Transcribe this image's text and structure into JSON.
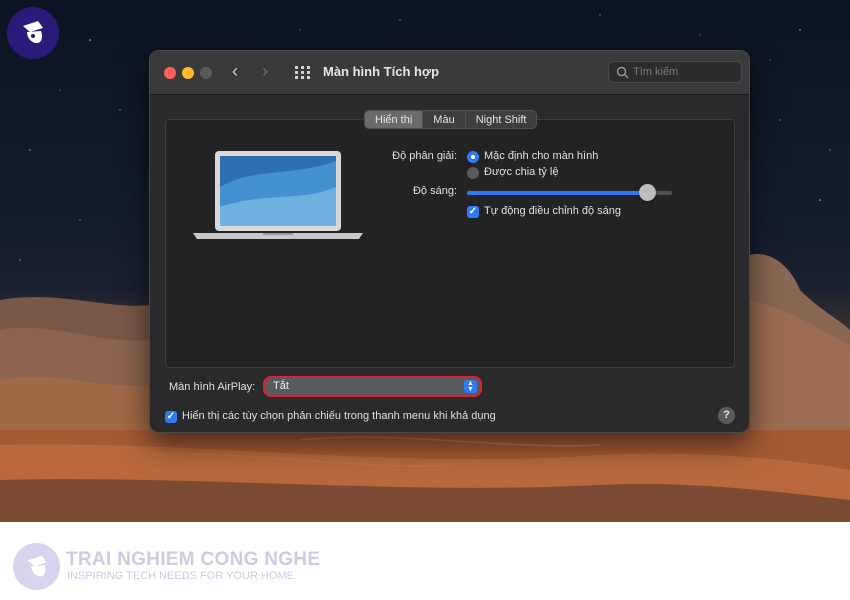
{
  "window": {
    "title": "Màn hình Tích hợp",
    "search_placeholder": "Tìm kiếm"
  },
  "tabs": [
    {
      "label": "Hiển thị",
      "active": true
    },
    {
      "label": "Màu",
      "active": false
    },
    {
      "label": "Night Shift",
      "active": false
    }
  ],
  "resolution": {
    "label": "Độ phân giải:",
    "options": [
      {
        "label": "Mặc định cho màn hình",
        "selected": true
      },
      {
        "label": "Được chia tỷ lệ",
        "selected": false
      }
    ]
  },
  "brightness": {
    "label": "Độ sáng:",
    "level": 0.88,
    "auto_label": "Tự động điều chỉnh độ sáng",
    "auto_checked": true
  },
  "airplay": {
    "label": "Màn hình AirPlay:",
    "value": "Tắt"
  },
  "mirroring": {
    "label": "Hiển thị các tùy chọn phản chiếu trong thanh menu khi khả dụng",
    "checked": true
  },
  "help": "?",
  "brand": {
    "title": "TRAI NGHIEM CONG NGHE",
    "subtitle": "INSPIRING TECH NEEDS FOR YOUR HOME"
  },
  "colors": {
    "accent": "#2f7bf5",
    "highlight": "#e0202a"
  }
}
